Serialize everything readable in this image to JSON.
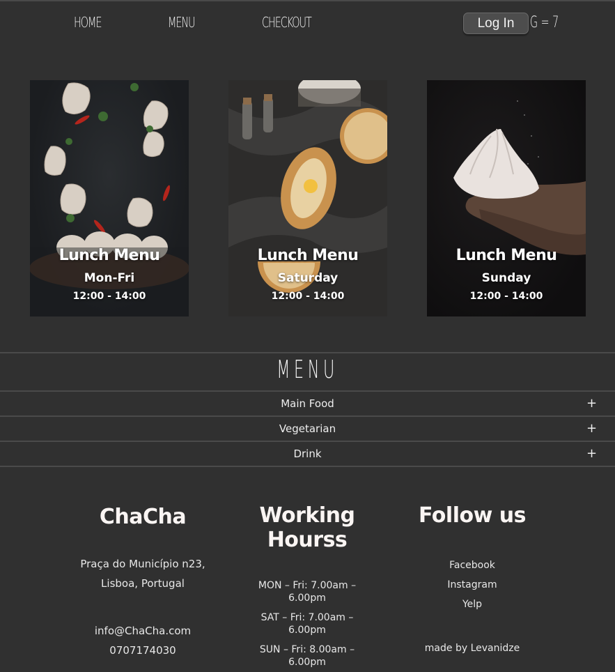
{
  "nav": {
    "links": [
      "HOME",
      "MENU",
      "CHECKOUT"
    ],
    "login_label": "Log In",
    "cart_label": "G = 7"
  },
  "cards": [
    {
      "title": "Lunch Menu",
      "day": "Mon-Fri",
      "time": "12:00 - 14:00",
      "image": "flying-khinkali-dumplings"
    },
    {
      "title": "Lunch Menu",
      "day": "Saturday",
      "time": "12:00 - 14:00",
      "image": "khachapuri-bread"
    },
    {
      "title": "Lunch Menu",
      "day": "Sunday",
      "time": "12:00 - 14:00",
      "image": "hand-holding-dumpling"
    }
  ],
  "menu": {
    "title": "MENU",
    "categories": [
      {
        "label": "Main Food",
        "icon": "+"
      },
      {
        "label": "Vegetarian",
        "icon": "+"
      },
      {
        "label": "Drink",
        "icon": "+"
      }
    ]
  },
  "footer": {
    "brand": {
      "name": "ChaCha",
      "address_line1": "Praça do Município n23,",
      "address_line2": "Lisboa, Portugal",
      "email": "info@ChaCha.com",
      "phone": "0707174030"
    },
    "hours": {
      "title_line1": "Working",
      "title_line2": "Hourss",
      "items": [
        "MON – Fri: 7.00am – 6.00pm",
        "SAT – Fri: 7.00am – 6.00pm",
        "SUN – Fri: 8.00am – 6.00pm"
      ]
    },
    "follow": {
      "title": "Follow us",
      "links": [
        "Facebook",
        "Instagram",
        "Yelp"
      ],
      "credit": "made by Levanidze"
    }
  },
  "colors": {
    "background": "#303030",
    "divider": "#4a4a4a",
    "text": "#f4f4f4",
    "button": "#4d4d4d"
  }
}
